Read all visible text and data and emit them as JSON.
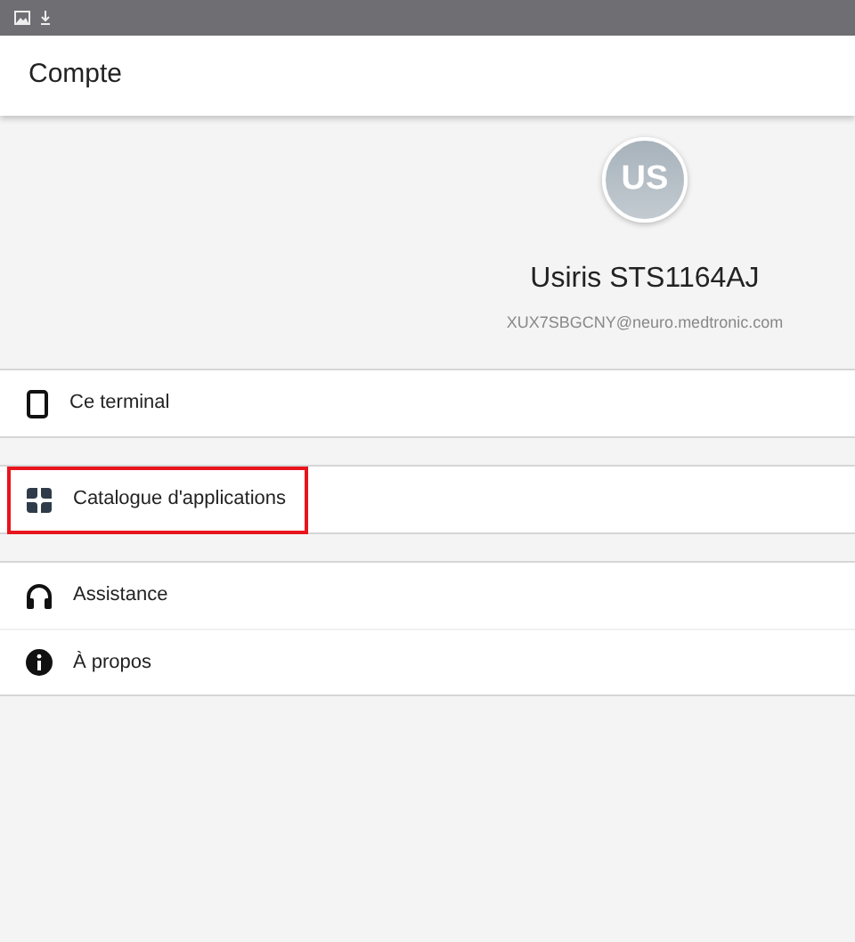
{
  "app_bar": {
    "title": "Compte"
  },
  "profile": {
    "initials": "US",
    "name": "Usiris STS1164AJ",
    "email": "XUX7SBGCNY@neuro.medtronic.com"
  },
  "menu_groups": [
    [
      {
        "label": "Ce terminal",
        "highlighted": false
      }
    ],
    [
      {
        "label": "Catalogue d'applications",
        "highlighted": true
      }
    ],
    [
      {
        "label": "Assistance",
        "highlighted": false
      },
      {
        "label": "À propos",
        "highlighted": false
      }
    ]
  ]
}
